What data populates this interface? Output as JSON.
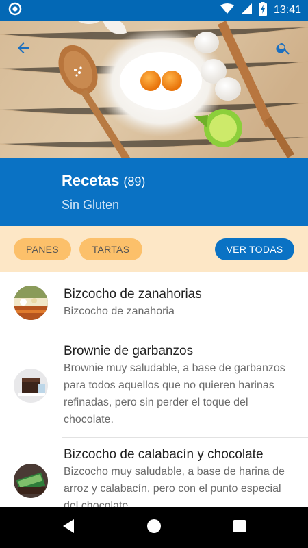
{
  "status_bar": {
    "time": "13:41",
    "icons": [
      "app-notification-icon",
      "wifi-icon",
      "signal-icon",
      "battery-charging-icon"
    ]
  },
  "toolbar": {
    "back_icon": "arrow-back-icon",
    "search_icon": "search-icon"
  },
  "header": {
    "title": "Recetas",
    "count": "(89)",
    "subtitle": "Sin Gluten"
  },
  "filters": {
    "chips": [
      {
        "label": "PANES"
      },
      {
        "label": "TARTAS"
      }
    ],
    "view_all_label": "VER TODAS"
  },
  "recipes": [
    {
      "title": "Bizcocho de zanahorias",
      "description": "Bizcocho de zanahoria"
    },
    {
      "title": "Brownie de garbanzos",
      "description": "Brownie muy saludable, a base de garbanzos para todos aquellos que no quieren harinas refinadas, pero sin perder el toque del chocolate."
    },
    {
      "title": "Bizcocho de calabacín y chocolate",
      "description": "Bizcocho muy saludable, a base de harina de arroz y calabacín, pero con el punto especial del chocolate."
    }
  ],
  "colors": {
    "status_bar": "#0368b5",
    "primary": "#0a72c4",
    "filter_background": "#fde7c6",
    "chip": "#fcc06a"
  },
  "nav_bar": {
    "icons": [
      "back-triangle-icon",
      "home-circle-icon",
      "recents-square-icon"
    ]
  }
}
